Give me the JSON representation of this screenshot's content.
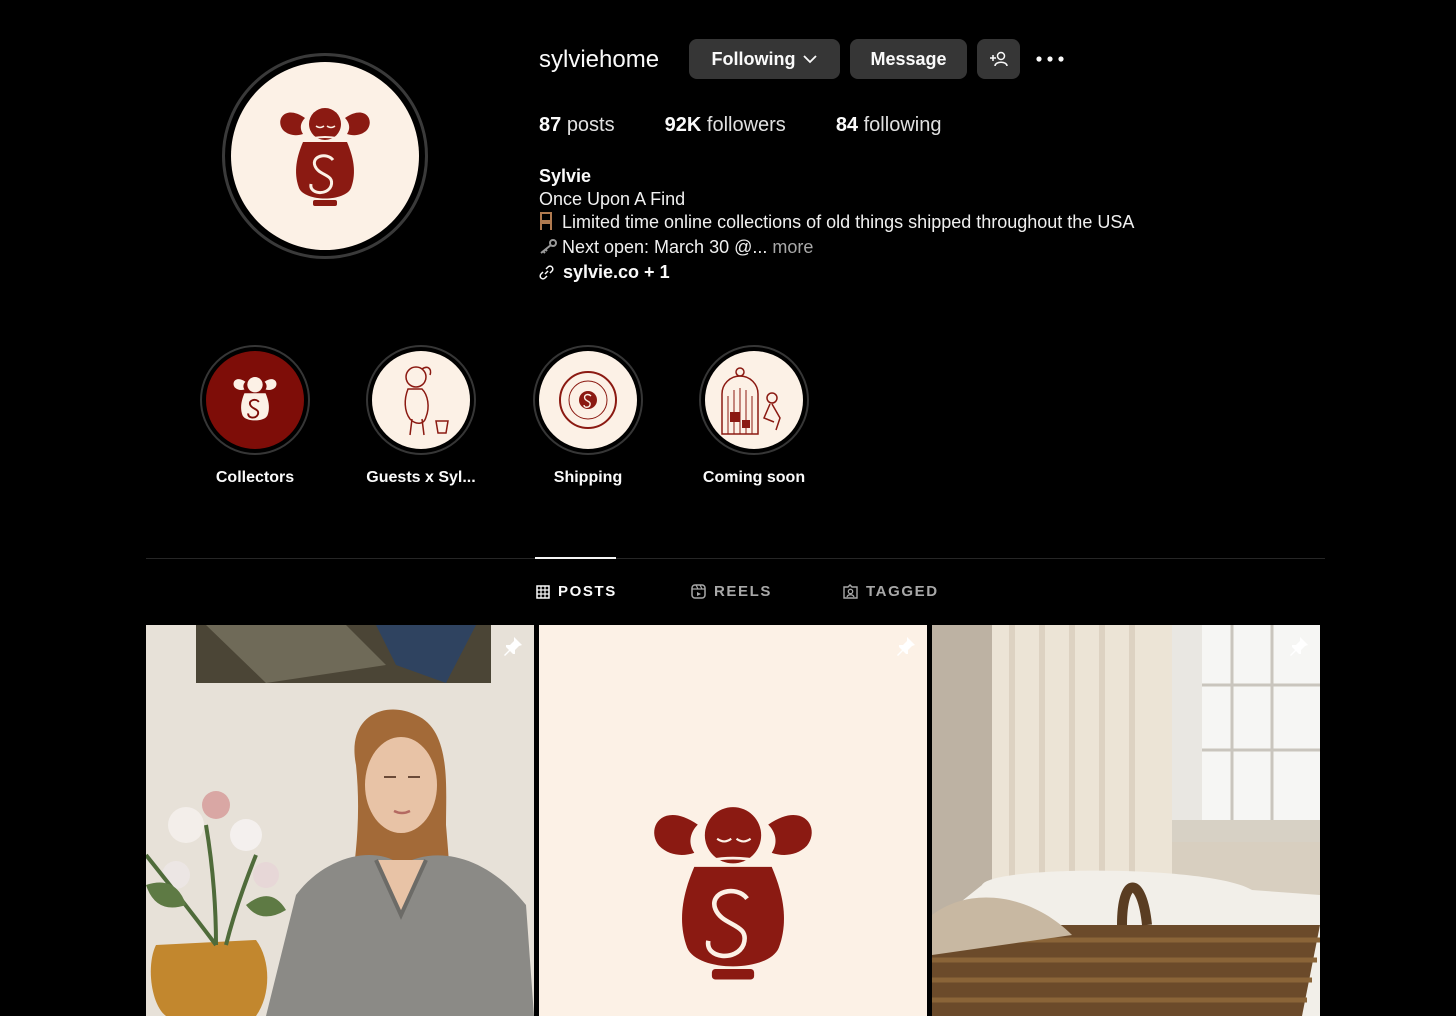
{
  "profile": {
    "username": "sylviehome",
    "following_label": "Following",
    "message_label": "Message",
    "posts_count": "87",
    "posts_label": "posts",
    "followers_count": "92K",
    "followers_label": "followers",
    "following_count": "84",
    "following_count_label": "following"
  },
  "bio": {
    "name": "Sylvie",
    "line1": "Once Upon A Find",
    "line2": "Limited time online collections of old things shipped throughout the USA",
    "line3": "Next open: March 30 @...",
    "more": "more",
    "link": "sylvie.co + 1"
  },
  "highlights": [
    {
      "label": "Collectors"
    },
    {
      "label": "Guests x Syl..."
    },
    {
      "label": "Shipping"
    },
    {
      "label": "Coming soon"
    }
  ],
  "tabs": {
    "posts": "POSTS",
    "reels": "REELS",
    "tagged": "TAGGED"
  },
  "colors": {
    "background": "#000000",
    "button": "#363636",
    "brand_red": "#8b1a12",
    "cream": "#fcf1e6"
  },
  "icons": {
    "chevron": "chevron-down-icon",
    "add_user": "add-user-icon",
    "more": "more-options-icon",
    "pin": "pin-icon",
    "posts": "grid-icon",
    "reels": "reels-icon",
    "tagged": "tagged-icon"
  }
}
